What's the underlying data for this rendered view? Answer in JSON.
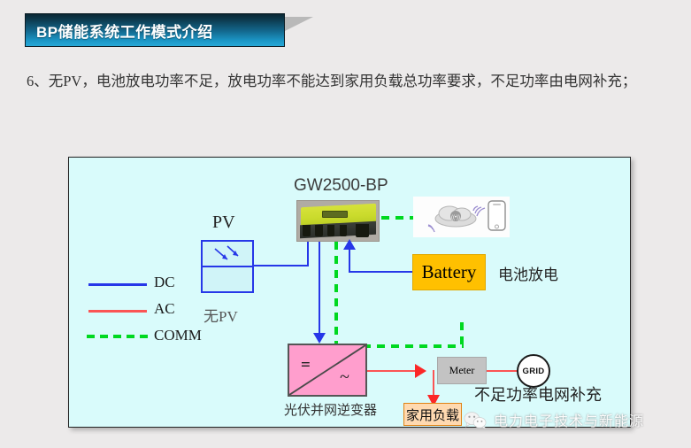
{
  "slide": {
    "title": "BP储能系统工作模式介绍",
    "paragraph": "6、无PV，电池放电功率不足，放电功率不能达到家用负载总功率要求，不足功率由电网补充；"
  },
  "legend": {
    "items": [
      {
        "label": "DC",
        "style": "solid",
        "color": "#2637e8"
      },
      {
        "label": "AC",
        "style": "solid",
        "color": "#fb5454"
      },
      {
        "label": "COMM",
        "style": "dashed",
        "color": "#00d820"
      }
    ]
  },
  "diagram": {
    "pv": {
      "title": "PV",
      "status": "无PV"
    },
    "inverter": {
      "title": "GW2500-BP"
    },
    "battery": {
      "label": "Battery",
      "note": "电池放电"
    },
    "converter": {
      "caption": "光伏并网逆变器",
      "dc_symbol": "=",
      "ac_symbol": "~"
    },
    "meter": {
      "label": "Meter"
    },
    "grid": {
      "label": "GRID",
      "note": "不足功率电网补充"
    },
    "load": {
      "label": "家用负载"
    },
    "cloud": {
      "icon": "cloud-wifi-phone-icon"
    }
  },
  "footer": {
    "icon": "wechat-icon",
    "text": "电力电子技术与新能源"
  },
  "colors": {
    "dc": "#2637e8",
    "ac": "#fb5454",
    "comm": "#00d820",
    "battery": "#ffc000",
    "converter": "#ff9ecd",
    "load": "#ffd9b0",
    "diagram_bg": "#d9fbfb",
    "title_accent": "#27a9d8"
  }
}
